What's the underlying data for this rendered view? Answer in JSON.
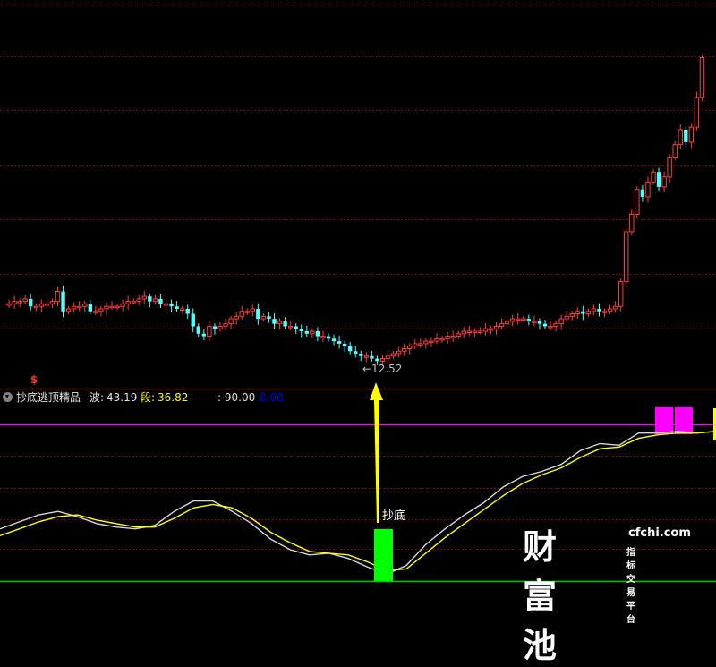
{
  "indicator": {
    "name": "抄底逃顶精品",
    "wave_label": "波:",
    "wave_value": "43.19",
    "segment_label": "段:",
    "segment_value": "36.82",
    "level_value": ": 90.00",
    "zero_value": "0.00"
  },
  "price_panel": {
    "low_marker": "←12.52",
    "s_mark": "$"
  },
  "signal": {
    "label": "抄底"
  },
  "watermark": {
    "logo": "财富池",
    "site": "cfchi.com",
    "subtitle": "指标交易平台"
  },
  "colors": {
    "background": "#000000",
    "grid": "#8b0000",
    "up_candle": "#ff3c3c",
    "down_candle": "#54ffff",
    "wave_line": "#e0e0e0",
    "segment_line": "#ffff00",
    "level_line": "#ff00ff",
    "buy_bar": "#00ff00",
    "arrow": "#ffff00"
  },
  "chart_data": [
    {
      "type": "candlestick",
      "title": "",
      "low_annotation": 12.52,
      "close_path": [
        14.9,
        14.9,
        15.0,
        15.0,
        15.1,
        14.8,
        14.8,
        14.9,
        14.9,
        15.0,
        15.4,
        14.6,
        14.7,
        14.8,
        14.8,
        14.9,
        14.6,
        14.6,
        14.7,
        14.8,
        14.8,
        14.8,
        14.9,
        15.0,
        15.0,
        15.1,
        15.2,
        15.0,
        15.1,
        14.9,
        14.9,
        14.8,
        14.7,
        14.7,
        14.5,
        14.0,
        13.7,
        13.6,
        14.0,
        13.9,
        14.0,
        14.1,
        14.3,
        14.4,
        14.6,
        14.6,
        14.7,
        14.3,
        14.4,
        14.3,
        14.1,
        14.2,
        14.0,
        14.0,
        13.9,
        13.8,
        13.7,
        13.8,
        13.6,
        13.6,
        13.5,
        13.4,
        13.3,
        13.2,
        13.0,
        12.9,
        12.8,
        12.8,
        12.7,
        12.6,
        12.7,
        12.8,
        12.9,
        13.0,
        13.1,
        13.2,
        13.3,
        13.3,
        13.4,
        13.4,
        13.5,
        13.5,
        13.6,
        13.6,
        13.7,
        13.8,
        13.8,
        13.8,
        13.8,
        13.9,
        13.9,
        14.0,
        14.1,
        14.2,
        14.3,
        14.3,
        14.3,
        14.2,
        14.2,
        14.1,
        14.0,
        14.0,
        14.1,
        14.3,
        14.4,
        14.5,
        14.6,
        14.5,
        14.6,
        14.7,
        14.6,
        14.6,
        14.7,
        14.8,
        15.8,
        17.8,
        18.5,
        19.5,
        19.2,
        19.8,
        20.2,
        19.6,
        20.0,
        20.8,
        21.3,
        21.9,
        21.4,
        22.0,
        23.2,
        24.8
      ]
    },
    {
      "type": "line",
      "title": "抄底逃顶精品",
      "level_line": 90.0,
      "zero_line": 0.0,
      "series": [
        {
          "name": "波",
          "last_value": 43.19,
          "values": [
            30,
            34,
            38,
            40,
            37,
            33,
            31,
            30,
            32,
            40,
            46,
            46,
            40,
            33,
            24,
            18,
            15,
            16,
            13,
            8,
            4,
            9,
            21,
            30,
            38,
            45,
            54,
            60,
            63,
            67,
            75,
            79,
            78,
            85,
            85,
            86,
            85,
            86
          ]
        },
        {
          "name": "段",
          "last_value": 36.82,
          "values": [
            26,
            30,
            34,
            37,
            38,
            35,
            33,
            31,
            31,
            36,
            42,
            44,
            42,
            36,
            28,
            22,
            17,
            16,
            15,
            11,
            6,
            7,
            16,
            25,
            33,
            41,
            49,
            56,
            61,
            65,
            71,
            76,
            77,
            82,
            84,
            85,
            85,
            86
          ]
        }
      ],
      "signals": [
        {
          "label": "抄底",
          "bar_index": 19
        }
      ]
    }
  ]
}
